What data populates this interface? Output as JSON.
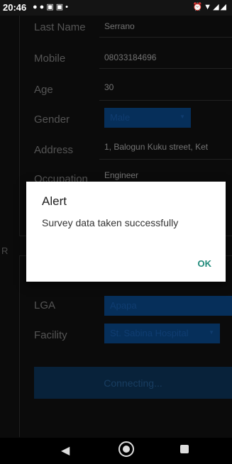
{
  "status_bar": {
    "time": "20:46",
    "left_icons": [
      "location-pin-icon",
      "location-pin-icon",
      "image-icon",
      "image-icon",
      "dot-icon"
    ],
    "right_icons": [
      "alarm-icon",
      "wifi-icon",
      "signal-icon",
      "signal-icon"
    ]
  },
  "form": {
    "last_name_label": "Last Name",
    "last_name_value": "Serrano",
    "mobile_label": "Mobile",
    "mobile_value": "08033184696",
    "age_label": "Age",
    "age_value": "30",
    "gender_label": "Gender",
    "gender_value": "Male",
    "address_label": "Address",
    "address_value": "1, Balogun Kuku street, Ket",
    "occupation_label": "Occupation",
    "occupation_value": "Engineer",
    "section_letter": "R",
    "lga_label": "LGA",
    "lga_value": "Apapa",
    "facility_label": "Facility",
    "facility_value": "St. Sabina Hospital"
  },
  "connect_button": {
    "label": "Connecting..."
  },
  "dialog": {
    "title": "Alert",
    "message": "Survey data taken successfully",
    "ok_label": "OK"
  },
  "colors": {
    "accent": "#1f8a7a",
    "spinner_blue": "#0b57a4"
  }
}
